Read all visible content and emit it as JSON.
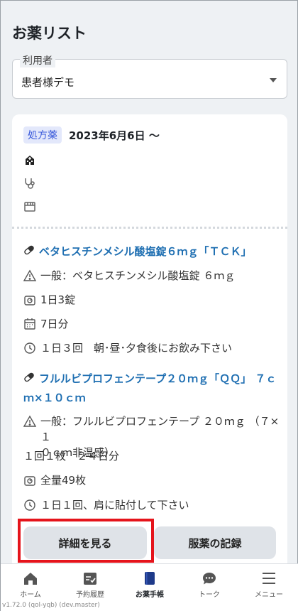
{
  "header": {
    "title": "お薬リスト"
  },
  "user_select": {
    "legend": "利用者",
    "value": "患者様デモ"
  },
  "prescription": {
    "badge": "処方薬",
    "date": "2023年6月6日 〜",
    "drugs": [
      {
        "name": "ベタヒスチンメシル酸塩錠６ｍｇ「ＴＣＫ」",
        "generic": "一般：ベタヒスチンメシル酸塩錠 ６ｍｇ",
        "dose": "1日3錠",
        "days": "7日分",
        "usage": "１日３回　朝･昼･夕食後にお飲み下さい"
      },
      {
        "name_line1": "フルルビプロフェンテープ２０ｍｇ「ＱＱ」 ７ｃ",
        "name_line2": "ｍ×１０ｃｍ",
        "generic_line1": "一般：フルルビプロフェンテープ ２０ｍｇ （７×１",
        "generic_line2": "０ｃｍ非温感）",
        "generic_line3": "１回１枚　２４日分",
        "total": "全量49枚",
        "usage": "１日１回、肩に貼付して下さい"
      }
    ]
  },
  "actions": {
    "detail": "詳細を見る",
    "record": "服薬の記録"
  },
  "tabs": [
    {
      "label": "ホーム",
      "icon": "home-icon"
    },
    {
      "label": "予約履歴",
      "icon": "calendar-check-icon"
    },
    {
      "label": "お薬手帳",
      "icon": "medicine-notebook-icon"
    },
    {
      "label": "トーク",
      "icon": "chat-icon"
    },
    {
      "label": "メニュー",
      "icon": "menu-icon"
    }
  ],
  "version": "v1.72.0 (qol-yqb) (dev.master)",
  "colors": {
    "accent": "#1f6fb2",
    "badge_bg": "#e3e8fb",
    "highlight": "#e5141b",
    "active_tab": "#1e3a8a"
  }
}
